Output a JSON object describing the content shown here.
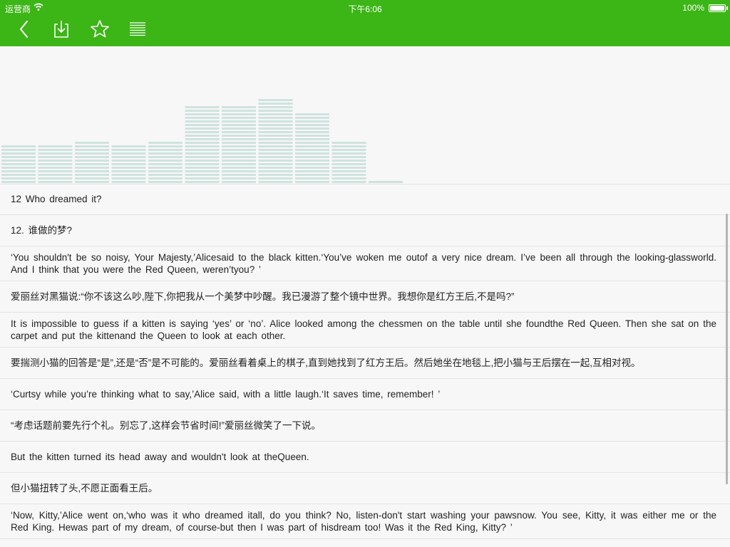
{
  "status_bar": {
    "carrier": "运营商",
    "time": "下午6:06",
    "battery": "100%"
  },
  "toolbar": {
    "back_icon": "chevron-left-icon",
    "download_icon": "download-icon",
    "favorite_icon": "star-icon",
    "menu_icon": "list-icon",
    "accent_color": "#3cb516"
  },
  "audio_visualizer": {
    "levels": [
      0.33,
      0.33,
      0.38,
      0.33,
      0.38,
      0.7,
      0.7,
      0.75,
      0.63,
      0.38,
      0.04
    ],
    "bar_color": "#cfe3de"
  },
  "lines": [
    "12 Who dreamed it?",
    "12. 谁做的梦?",
    "‘You shouldn't be so noisy, Your Majesty,’Alicesaid to the black kitten.‘You’ve woken me outof a very nice dream. I’ve been all through the looking-glassworld. And I think that you were the Red Queen, weren’tyou? ’",
    "爱丽丝对黑猫说:“你不该这么吵,陛下,你把我从一个美梦中吵醒。我已漫游了整个镜中世界。我想你是红方王后,不是吗?”",
    "It is impossible to guess if a kitten is saying ‘yes’ or ‘no’. Alice looked among the chessmen on the table until she foundthe Red Queen. Then she sat on the carpet and put the kittenand the Queen to look at each other.",
    "要揣测小猫的回答是“是”,还是“否”是不可能的。爱丽丝看着桌上的棋子,直到她找到了红方王后。然后她坐在地毯上,把小猫与王后摆在一起,互相对视。",
    "‘Curtsy while you’re thinking what to say,’Alice said, with a little laugh.‘It saves time, remember! ’",
    "“考虑话题前要先行个礼。别忘了,这样会节省时间!”爱丽丝微笑了一下说。",
    "But the kitten turned its head away and wouldn't look at theQueen.",
    "但小猫扭转了头,不愿正面看王后。",
    "‘Now, Kitty,’Alice went on,‘who was it who dreamed itall, do you think? No, listen-don't start washing your pawsnow. You see, Kitty, it was either me or the Red King. Hewas part of my dream, of course-but then I was part of hisdream too! Was it the Red King, Kitty? ’"
  ]
}
